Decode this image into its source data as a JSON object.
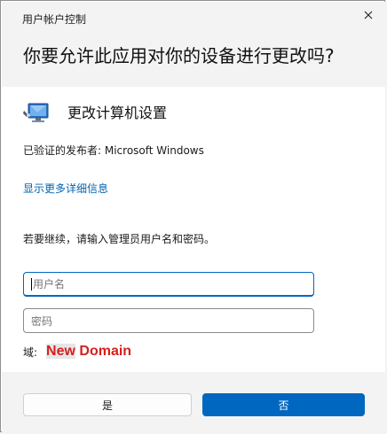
{
  "window": {
    "title": "用户帐户控制",
    "question": "你要允许此应用对你的设备进行更改吗?"
  },
  "app": {
    "name": "更改计算机设置",
    "icon": "computer-settings-icon"
  },
  "publisher": {
    "text": "已验证的发布者: Microsoft Windows"
  },
  "details_link": "显示更多详细信息",
  "prompt": "若要继续，请输入管理员用户名和密码。",
  "username": {
    "placeholder": "用户名",
    "value": ""
  },
  "password": {
    "placeholder": "密码",
    "value": ""
  },
  "domain": {
    "label": "域:",
    "value_highlight": "New",
    "value_rest": " Domain"
  },
  "buttons": {
    "yes": "是",
    "no": "否"
  },
  "colors": {
    "accent": "#0067c0",
    "link": "#0063b1",
    "domain_text": "#d61f1f"
  }
}
